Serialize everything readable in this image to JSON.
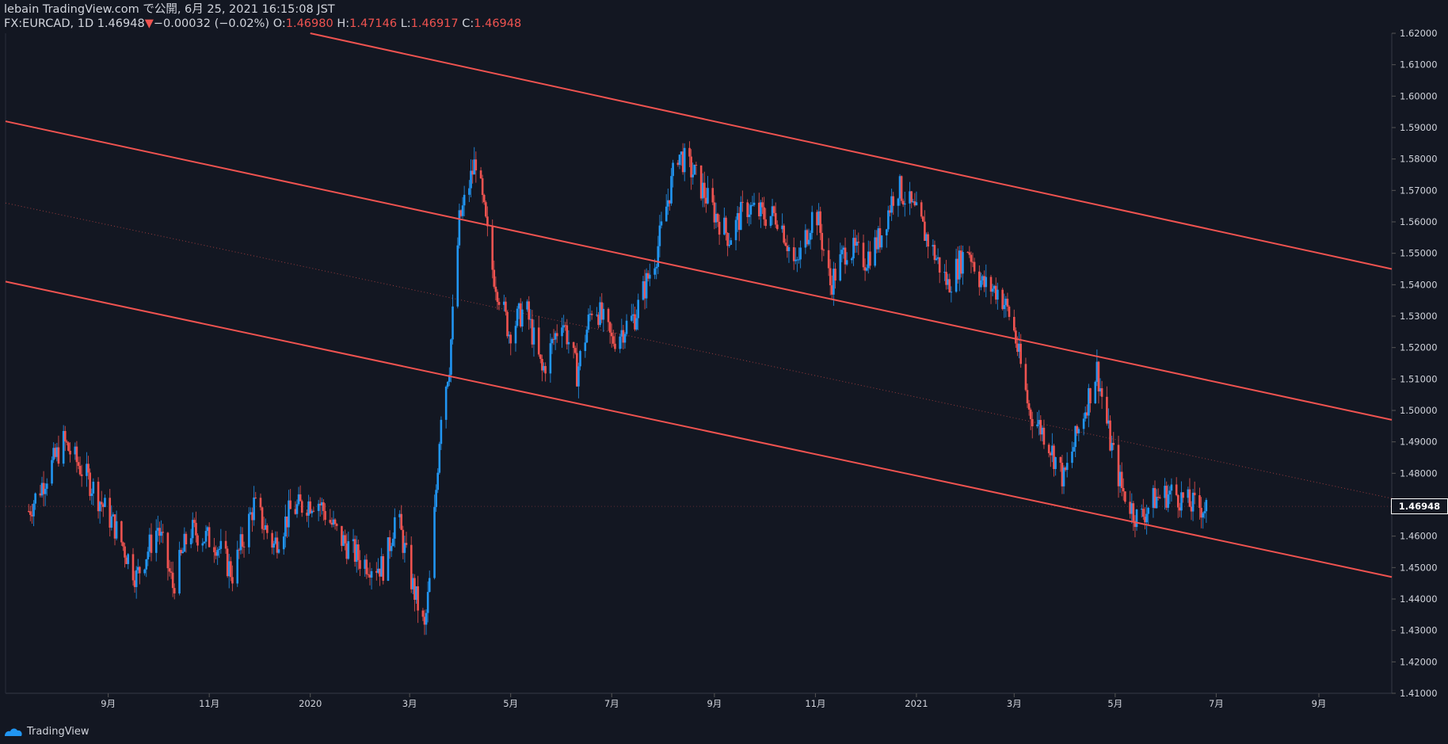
{
  "header": {
    "line1": "lebain TradingView.com で公開, 6月 25, 2021 16:15:08 JST",
    "symbol_line": "FX:EURCAD, 1D 1.46948",
    "change": "−0.00032 (−0.02%)",
    "o_label": "O:",
    "o_value": "1.46980",
    "h_label": "H:",
    "h_value": "1.47146",
    "l_label": "L:",
    "l_value": "1.46917",
    "c_label": "C:",
    "c_value": "1.46948"
  },
  "footer": {
    "brand": "TradingView"
  },
  "colors": {
    "background": "#131722",
    "up": "#2196f3",
    "down": "#ef5350",
    "channel": "#f05350",
    "text": "#d1d4dc"
  },
  "chart_data": {
    "type": "candlestick",
    "symbol": "FX:EURCAD",
    "interval": "1D",
    "ylim": [
      1.41,
      1.62
    ],
    "y_ticks": [
      "1.41000",
      "1.42000",
      "1.43000",
      "1.44000",
      "1.45000",
      "1.46000",
      "1.47000",
      "1.48000",
      "1.49000",
      "1.50000",
      "1.51000",
      "1.52000",
      "1.53000",
      "1.54000",
      "1.55000",
      "1.56000",
      "1.57000",
      "1.58000",
      "1.59000",
      "1.60000",
      "1.61000",
      "1.62000"
    ],
    "x_ticks": [
      {
        "label": "9月",
        "date": "2019-09"
      },
      {
        "label": "11月",
        "date": "2019-11"
      },
      {
        "label": "2020",
        "date": "2020-01"
      },
      {
        "label": "3月",
        "date": "2020-03"
      },
      {
        "label": "5月",
        "date": "2020-05"
      },
      {
        "label": "7月",
        "date": "2020-07"
      },
      {
        "label": "9月",
        "date": "2020-09"
      },
      {
        "label": "11月",
        "date": "2020-11"
      },
      {
        "label": "2021",
        "date": "2021-01"
      },
      {
        "label": "3月",
        "date": "2021-03"
      },
      {
        "label": "5月",
        "date": "2021-05"
      },
      {
        "label": "7月",
        "date": "2021-07"
      },
      {
        "label": "9月",
        "date": "2021-09"
      }
    ],
    "last_price": "1.46948",
    "price_path": [
      [
        "2019-07-15",
        1.468
      ],
      [
        "2019-08-05",
        1.49
      ],
      [
        "2019-08-20",
        1.478
      ],
      [
        "2019-09-05",
        1.463
      ],
      [
        "2019-09-18",
        1.447
      ],
      [
        "2019-10-01",
        1.463
      ],
      [
        "2019-10-10",
        1.444
      ],
      [
        "2019-10-20",
        1.462
      ],
      [
        "2019-11-05",
        1.458
      ],
      [
        "2019-11-15",
        1.448
      ],
      [
        "2019-11-28",
        1.47
      ],
      [
        "2019-12-10",
        1.457
      ],
      [
        "2019-12-20",
        1.468
      ],
      [
        "2020-01-05",
        1.472
      ],
      [
        "2020-01-18",
        1.46
      ],
      [
        "2020-02-01",
        1.452
      ],
      [
        "2020-02-15",
        1.45
      ],
      [
        "2020-02-22",
        1.468
      ],
      [
        "2020-03-01",
        1.448
      ],
      [
        "2020-03-10",
        1.43
      ],
      [
        "2020-03-14",
        1.45
      ],
      [
        "2020-03-20",
        1.5
      ],
      [
        "2020-03-25",
        1.515
      ],
      [
        "2020-03-31",
        1.56
      ],
      [
        "2020-04-10",
        1.58
      ],
      [
        "2020-04-20",
        1.545
      ],
      [
        "2020-04-30",
        1.525
      ],
      [
        "2020-05-10",
        1.533
      ],
      [
        "2020-05-20",
        1.512
      ],
      [
        "2020-06-01",
        1.53
      ],
      [
        "2020-06-10",
        1.512
      ],
      [
        "2020-06-20",
        1.535
      ],
      [
        "2020-07-01",
        1.522
      ],
      [
        "2020-07-15",
        1.53
      ],
      [
        "2020-07-28",
        1.55
      ],
      [
        "2020-08-10",
        1.582
      ],
      [
        "2020-08-20",
        1.575
      ],
      [
        "2020-09-01",
        1.563
      ],
      [
        "2020-09-10",
        1.555
      ],
      [
        "2020-09-20",
        1.565
      ],
      [
        "2020-10-01",
        1.562
      ],
      [
        "2020-10-10",
        1.562
      ],
      [
        "2020-10-20",
        1.545
      ],
      [
        "2020-11-01",
        1.565
      ],
      [
        "2020-11-10",
        1.54
      ],
      [
        "2020-11-20",
        1.552
      ],
      [
        "2020-12-01",
        1.548
      ],
      [
        "2020-12-10",
        1.555
      ],
      [
        "2020-12-20",
        1.572
      ],
      [
        "2021-01-01",
        1.562
      ],
      [
        "2021-01-10",
        1.552
      ],
      [
        "2021-01-20",
        1.54
      ],
      [
        "2021-02-01",
        1.552
      ],
      [
        "2021-02-10",
        1.54
      ],
      [
        "2021-02-20",
        1.538
      ],
      [
        "2021-02-28",
        1.528
      ],
      [
        "2021-03-10",
        1.5
      ],
      [
        "2021-03-20",
        1.492
      ],
      [
        "2021-03-31",
        1.478
      ],
      [
        "2021-04-10",
        1.496
      ],
      [
        "2021-04-20",
        1.513
      ],
      [
        "2021-04-28",
        1.49
      ],
      [
        "2021-05-05",
        1.475
      ],
      [
        "2021-05-15",
        1.465
      ],
      [
        "2021-05-25",
        1.472
      ],
      [
        "2021-06-05",
        1.474
      ],
      [
        "2021-06-15",
        1.47
      ],
      [
        "2021-06-25",
        1.469
      ]
    ],
    "channel_lines": [
      {
        "name": "upper",
        "start": [
          "2020-01-01",
          1.62
        ],
        "end": [
          "2021-10-15",
          1.545
        ]
      },
      {
        "name": "middle",
        "start": [
          "2019-07-01",
          1.592
        ],
        "end": [
          "2021-10-15",
          1.497
        ]
      },
      {
        "name": "lower",
        "start": [
          "2019-07-01",
          1.541
        ],
        "end": [
          "2021-10-15",
          1.447
        ]
      }
    ],
    "median_line": {
      "start": [
        "2019-07-01",
        1.566
      ],
      "end": [
        "2021-10-15",
        1.472
      ]
    },
    "grid": false,
    "legend": "none"
  }
}
